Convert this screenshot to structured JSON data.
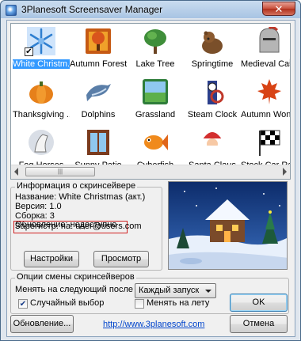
{
  "window": {
    "title": "3Planesoft Screensaver Manager",
    "close_glyph": "✕"
  },
  "screensavers": [
    {
      "label": "White Christm...",
      "icon": "snowflake-icon",
      "selected": true,
      "checked": true,
      "check_glyph": "✔"
    },
    {
      "label": "Autumn Forest",
      "icon": "autumn-forest-icon"
    },
    {
      "label": "Lake Tree",
      "icon": "tree-icon"
    },
    {
      "label": "Springtime",
      "icon": "bear-icon"
    },
    {
      "label": "Medieval Cast...",
      "icon": "knight-helmet-icon"
    },
    {
      "label": "Thanksgiving ...",
      "icon": "pumpkin-icon"
    },
    {
      "label": "Dolphins",
      "icon": "dolphin-icon"
    },
    {
      "label": "Grassland",
      "icon": "grassland-icon"
    },
    {
      "label": "Steam Clock",
      "icon": "steam-clock-icon"
    },
    {
      "label": "Autumn Wonder...",
      "icon": "maple-leaf-icon"
    },
    {
      "label": "Fog Horses",
      "icon": "horse-icon"
    },
    {
      "label": "Sunny Patio",
      "icon": "patio-door-icon"
    },
    {
      "label": "Cyberfish",
      "icon": "goldfish-icon"
    },
    {
      "label": "Santa Claus",
      "icon": "santa-icon"
    },
    {
      "label": "Stock Car Rac...",
      "icon": "checkered-flag-icon"
    }
  ],
  "partial_labels": [
    "Fa"
  ],
  "scroll_grip": "|||",
  "info": {
    "heading": "Информация о скринсейвере",
    "name_line": "Название: White Christmas (акт.)",
    "version_line": "Версия: 1.0",
    "build_line": "Сборка: 3",
    "update_line": "Обновление: недоступно",
    "reg_line": "Зарегистр. на:  user@users.com",
    "settings_button": "Настройки",
    "preview_button": "Просмотр"
  },
  "options": {
    "heading": "Опции смены скринсейверов",
    "change_label": "Менять на следующий после",
    "change_value": "Каждый запуск",
    "random_label": "Случайный выбор",
    "random_checked": true,
    "random_glyph": "✔",
    "live_label": "Менять на лету",
    "live_checked": false
  },
  "buttons": {
    "ok": "OK",
    "cancel": "Отмена",
    "update": "Обновление..."
  },
  "link": "http://www.3planesoft.com",
  "colors": {
    "accent": "#3399ff",
    "link": "#0044cc",
    "highlight_border": "#d02020"
  }
}
